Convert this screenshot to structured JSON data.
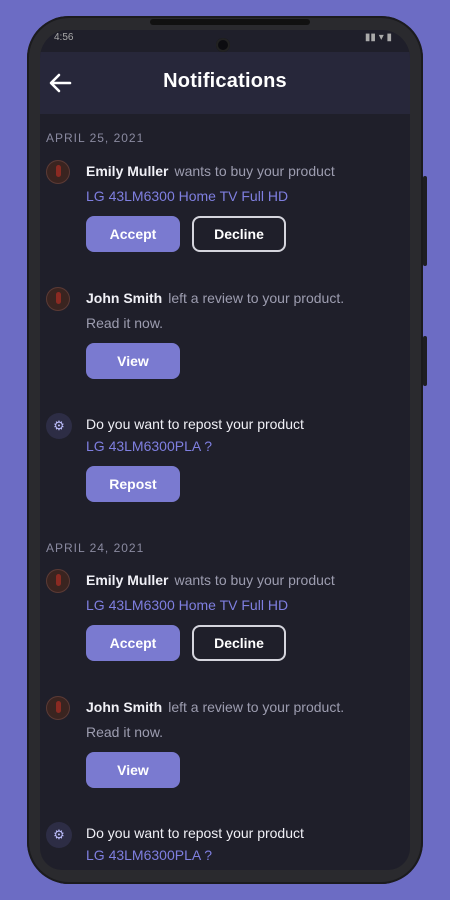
{
  "status": {
    "left": "4:56",
    "right": "▮▮ ▾ ▮"
  },
  "header": {
    "title": "Notifications"
  },
  "groups": [
    {
      "date": "APRIL 25, 2021",
      "items": [
        {
          "name": "Emily Muller",
          "text": "wants to buy your product",
          "product": "LG 43LM6300 Home TV Full HD",
          "accept": "Accept",
          "decline": "Decline"
        },
        {
          "name": "John Smith",
          "text": "left a review to your product.",
          "text2": "Read it now.",
          "view": "View"
        },
        {
          "text": "Do you want to repost your product",
          "product": "LG 43LM6300PLA ?",
          "repost": "Repost"
        }
      ]
    },
    {
      "date": "APRIL 24, 2021",
      "items": [
        {
          "name": "Emily Muller",
          "text": "wants to buy your product",
          "product": "LG 43LM6300 Home TV Full HD",
          "accept": "Accept",
          "decline": "Decline"
        },
        {
          "name": "John Smith",
          "text": "left a review to your product.",
          "text2": "Read it now.",
          "view": "View"
        },
        {
          "text": "Do you want to repost your product",
          "product": "LG 43LM6300PLA ?"
        }
      ]
    }
  ],
  "colors": {
    "background": "#6c6cc4",
    "accent": "#7a7ad0",
    "link": "#7f7fe0",
    "surface": "#1f1f2a"
  },
  "icons": {
    "back": "arrow-left-icon",
    "system": "gear-icon"
  }
}
